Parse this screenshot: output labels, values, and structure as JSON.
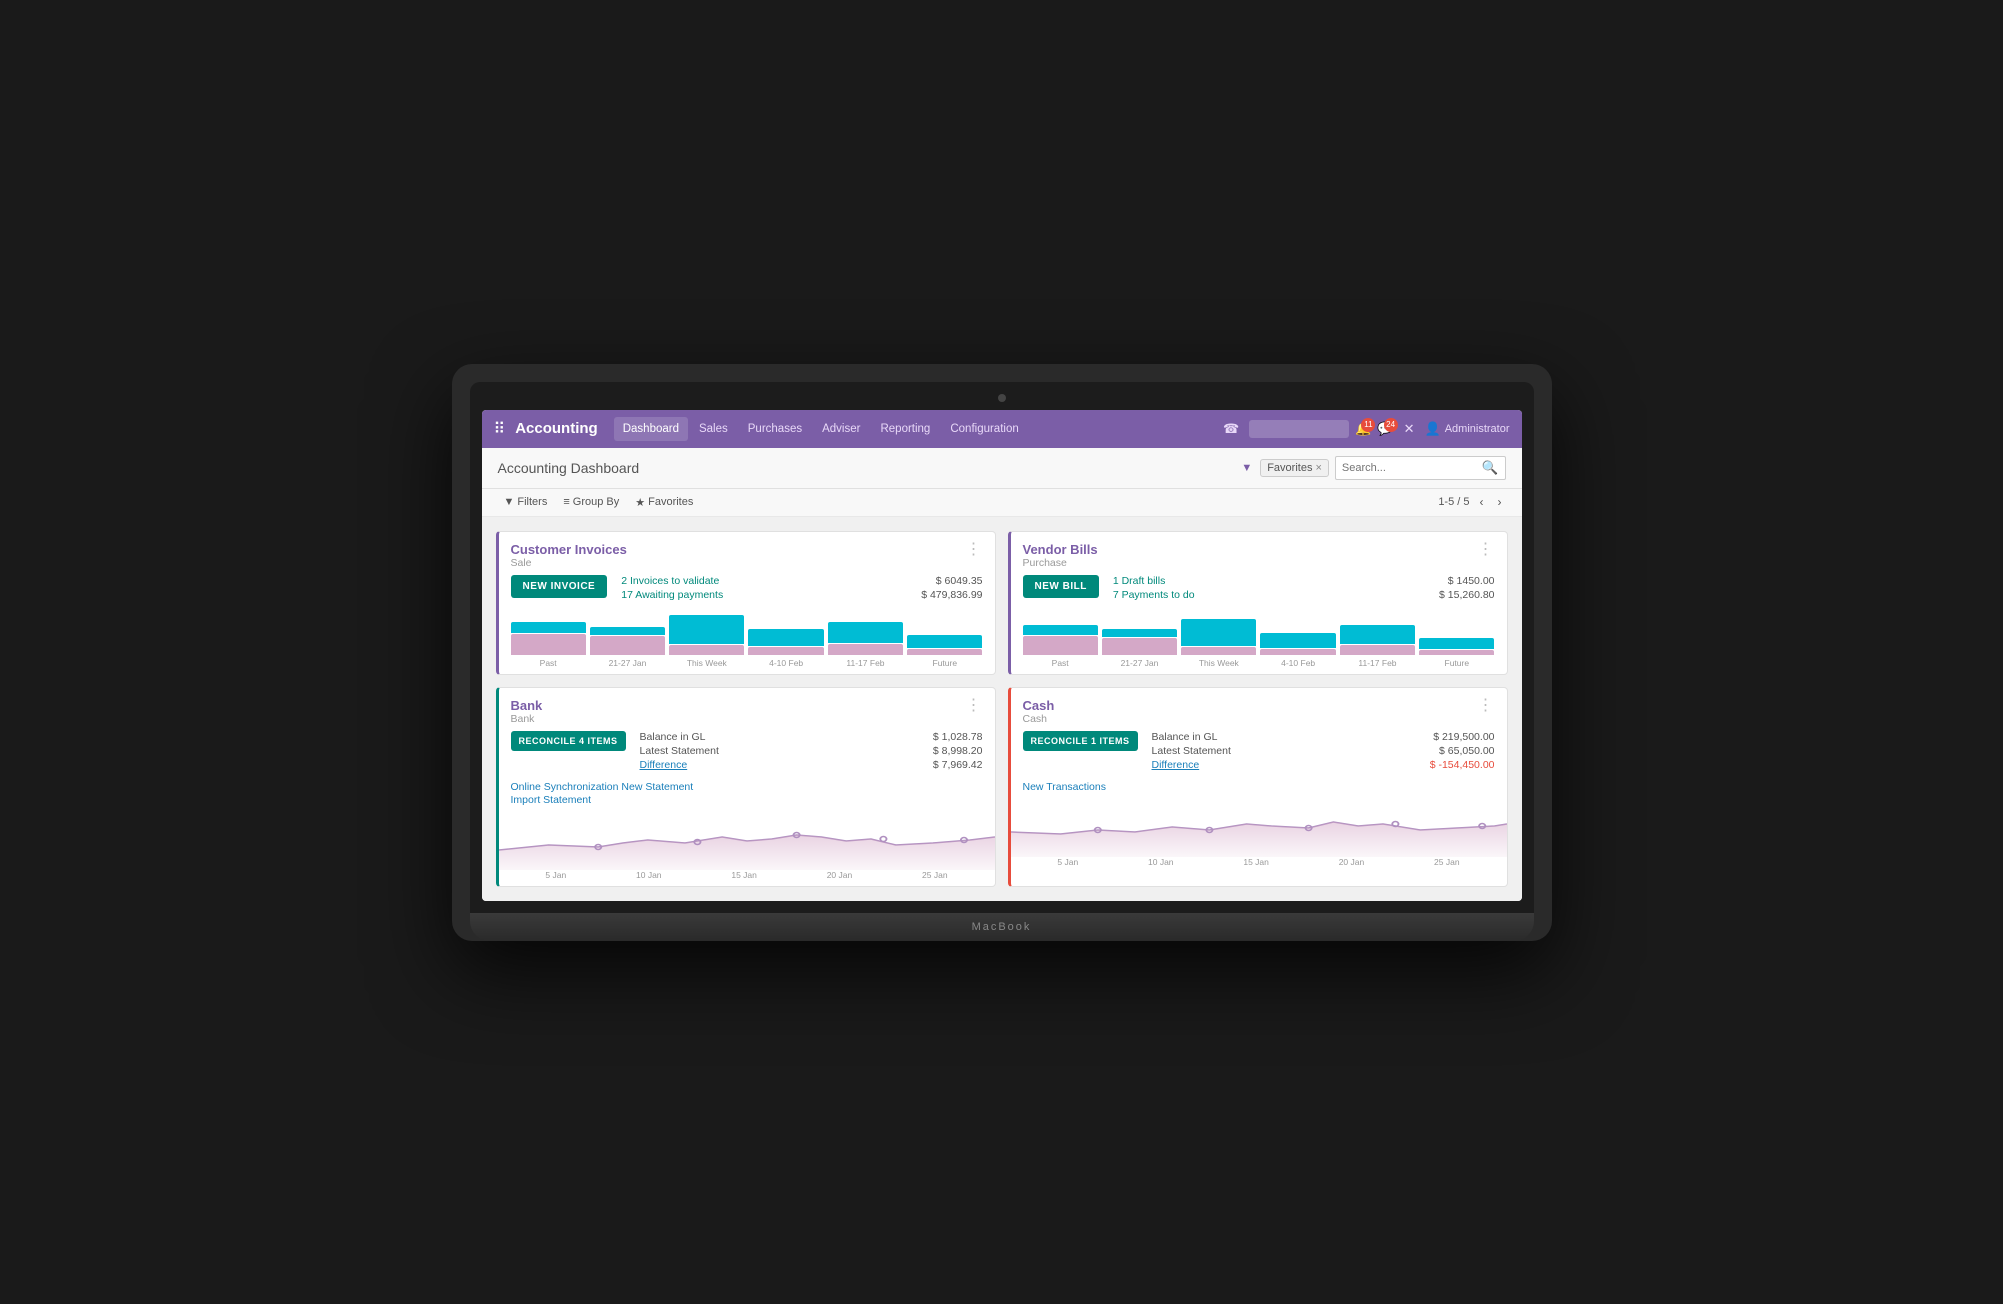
{
  "laptop": {
    "brand": "MacBook"
  },
  "app": {
    "name": "Accounting",
    "nav": {
      "items": [
        {
          "label": "Dashboard",
          "active": true
        },
        {
          "label": "Sales"
        },
        {
          "label": "Purchases"
        },
        {
          "label": "Adviser"
        },
        {
          "label": "Reporting"
        },
        {
          "label": "Configuration"
        }
      ]
    },
    "topbar": {
      "phone_icon": "☎",
      "search_placeholder": "",
      "badge1": "11",
      "badge2": "24",
      "close_icon": "✕",
      "user": "Administrator"
    }
  },
  "page": {
    "title": "Accounting Dashboard",
    "search": {
      "filter_label": "Favorites",
      "filter_close": "×",
      "placeholder": "Search..."
    },
    "toolbar": {
      "filters_label": "Filters",
      "groupby_label": "Group By",
      "favorites_label": "Favorites",
      "pagination": "1-5 / 5"
    }
  },
  "cards": {
    "customer_invoices": {
      "title": "Customer Invoices",
      "subtitle": "Sale",
      "btn_label": "NEW INVOICE",
      "stat1_label": "2 Invoices to validate",
      "stat1_value": "$ 6049.35",
      "stat2_label": "17 Awaiting payments",
      "stat2_value": "$ 479,836.99",
      "bars": [
        {
          "label": "Past",
          "pink": 22,
          "teal": 12
        },
        {
          "label": "21-27 Jan",
          "pink": 20,
          "teal": 8
        },
        {
          "label": "This Week",
          "pink": 10,
          "teal": 30
        },
        {
          "label": "4-10 Feb",
          "pink": 8,
          "teal": 18
        },
        {
          "label": "11-17 Feb",
          "pink": 12,
          "teal": 22
        },
        {
          "label": "Future",
          "pink": 6,
          "teal": 14
        }
      ]
    },
    "vendor_bills": {
      "title": "Vendor Bills",
      "subtitle": "Purchase",
      "btn_label": "NEW BILL",
      "stat1_label": "1 Draft bills",
      "stat1_value": "$ 1450.00",
      "stat2_label": "7 Payments to do",
      "stat2_value": "$ 15,260.80",
      "bars": [
        {
          "label": "Past",
          "pink": 20,
          "teal": 10
        },
        {
          "label": "21-27 Jan",
          "pink": 18,
          "teal": 8
        },
        {
          "label": "This Week",
          "pink": 8,
          "teal": 28
        },
        {
          "label": "4-10 Feb",
          "pink": 6,
          "teal": 16
        },
        {
          "label": "11-17 Feb",
          "pink": 10,
          "teal": 20
        },
        {
          "label": "Future",
          "pink": 5,
          "teal": 12
        }
      ]
    },
    "bank": {
      "title": "Bank",
      "subtitle": "Bank",
      "btn_label": "RECONCILE 4 ITEMS",
      "link1": "Online Synchronization New Statement",
      "link2": "Import Statement",
      "stat1_label": "Balance in GL",
      "stat1_value": "$ 1,028.78",
      "stat2_label": "Latest Statement",
      "stat2_value": "$ 8,998.20",
      "stat3_label": "Difference",
      "stat3_value": "$ 7,969.42",
      "line_labels": [
        "5 Jan",
        "10 Jan",
        "15 Jan",
        "20 Jan",
        "25 Jan"
      ],
      "border_color": "green"
    },
    "cash": {
      "title": "Cash",
      "subtitle": "Cash",
      "btn_label": "RECONCILE 1 ITEMS",
      "link1": "New Transactions",
      "stat1_label": "Balance in GL",
      "stat1_value": "$ 219,500.00",
      "stat2_label": "Latest Statement",
      "stat2_value": "$ 65,050.00",
      "stat3_label": "Difference",
      "stat3_value": "$ -154,450.00",
      "line_labels": [
        "5 Jan",
        "10 Jan",
        "15 Jan",
        "20 Jan",
        "25 Jan"
      ],
      "border_color": "red"
    }
  }
}
